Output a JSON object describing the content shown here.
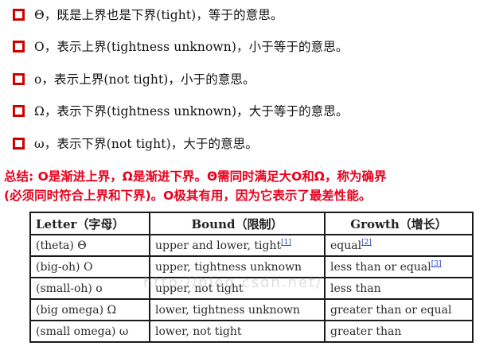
{
  "bullets": [
    {
      "text": "Θ，既是上界也是下界(tight)，等于的意思。"
    },
    {
      "text": "O，表示上界(tightness unknown)，小于等于的意思。"
    },
    {
      "text": "ο，表示上界(not tight)，小于的意思。"
    },
    {
      "text": "Ω，表示下界(tightness unknown)，大于等于的意思。"
    },
    {
      "text": "ω，表示下界(not tight)，大于的意思。"
    }
  ],
  "summary": {
    "line1": "总结: O是渐进上界，Ω是渐进下界。Θ需同时满足大O和Ω，称为确界",
    "line2": "(必须同时符合上界和下界)。O极其有用，因为它表示了最差性能。"
  },
  "table": {
    "headers": {
      "letter": "Letter（字母）",
      "bound": "Bound（限制）",
      "growth": "Growth（增长）"
    },
    "rows": [
      {
        "letter": "(theta) Θ",
        "bound": "upper and lower, tight",
        "bound_ref": "[1]",
        "growth": "equal",
        "growth_ref": "[2]"
      },
      {
        "letter": "(big-oh) O",
        "bound": "upper, tightness unknown",
        "bound_ref": "",
        "growth": "less than or equal",
        "growth_ref": "[3]"
      },
      {
        "letter": "(small-oh) o",
        "bound": "upper, not tight",
        "bound_ref": "",
        "growth": "less than",
        "growth_ref": ""
      },
      {
        "letter": "(big omega) Ω",
        "bound": "lower, tightness unknown",
        "bound_ref": "",
        "growth": "greater than or equal",
        "growth_ref": ""
      },
      {
        "letter": "(small omega) ω",
        "bound": "lower, not tight",
        "bound_ref": "",
        "growth": "greater than",
        "growth_ref": ""
      }
    ]
  },
  "watermark": "http://blog.csdn.net/",
  "colors": {
    "bullet_box": "#d00000",
    "summary_text": "#e8001c",
    "ref_link": "#1f3fbf"
  }
}
